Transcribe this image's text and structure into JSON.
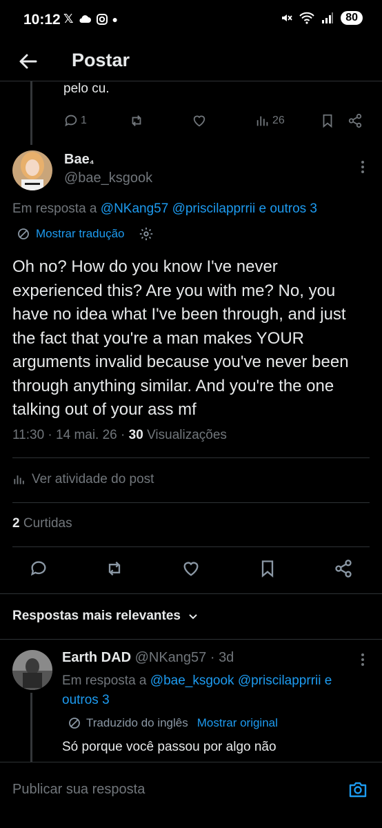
{
  "status": {
    "time": "10:12",
    "battery": "80"
  },
  "header": {
    "title": "Postar"
  },
  "previous_post": {
    "text_tail": "pelo cu.",
    "replies": "1",
    "views": "26"
  },
  "main_post": {
    "display_name": "Bae",
    "name_suffix": "₄",
    "handle": "@bae_ksgook",
    "reply_prefix": "Em resposta a",
    "reply_to": "@NKang57 @priscilapprrii e outros 3",
    "translate_label": "Mostrar tradução",
    "text": "Oh no? How do you know I've never experienced this? Are you with me? No, you have no idea what I've been through, and just the fact that you're a man makes YOUR arguments invalid because you've never been through anything similar. And you're the one talking out of your ass mf",
    "time": "11:30",
    "date": "14 mai. 26",
    "views_count": "30",
    "views_label": "Visualizações",
    "activity_label": "Ver atividade do post",
    "likes_count": "2",
    "likes_label": "Curtidas"
  },
  "replies_section": {
    "sort_label": "Respostas mais relevantes"
  },
  "reply": {
    "display_name": "Earth DAD",
    "handle": "@NKang57",
    "age": "3d",
    "reply_prefix": "Em resposta a",
    "reply_to_line1": "@bae_ksgook @priscilapprrii e",
    "reply_to_line2": "outros 3",
    "translated_label": "Traduzido do inglês",
    "show_original": "Mostrar original",
    "text": "Só porque você passou por algo não"
  },
  "composer": {
    "placeholder": "Publicar sua resposta"
  },
  "colors": {
    "background": "#000000",
    "text": "#e7e9ea",
    "muted": "#71767b",
    "link": "#1d9bf0",
    "divider": "#2f3336"
  }
}
